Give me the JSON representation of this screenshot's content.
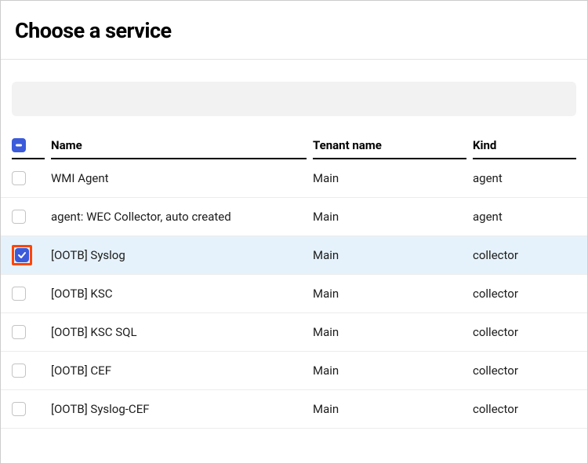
{
  "title": "Choose a service",
  "columns": {
    "name": "Name",
    "tenant": "Tenant name",
    "kind": "Kind"
  },
  "header_checkbox_state": "indeterminate",
  "rows": [
    {
      "checked": false,
      "highlighted": false,
      "name": "WMI Agent",
      "tenant": "Main",
      "kind": "agent"
    },
    {
      "checked": false,
      "highlighted": false,
      "name": "agent: WEC Collector, auto created",
      "tenant": "Main",
      "kind": "agent"
    },
    {
      "checked": true,
      "highlighted": true,
      "name": "[OOTB] Syslog",
      "tenant": "Main",
      "kind": "collector"
    },
    {
      "checked": false,
      "highlighted": false,
      "name": "[OOTB] KSC",
      "tenant": "Main",
      "kind": "collector"
    },
    {
      "checked": false,
      "highlighted": false,
      "name": "[OOTB] KSC SQL",
      "tenant": "Main",
      "kind": "collector"
    },
    {
      "checked": false,
      "highlighted": false,
      "name": "[OOTB] CEF",
      "tenant": "Main",
      "kind": "collector"
    },
    {
      "checked": false,
      "highlighted": false,
      "name": "[OOTB] Syslog-CEF",
      "tenant": "Main",
      "kind": "collector"
    }
  ]
}
